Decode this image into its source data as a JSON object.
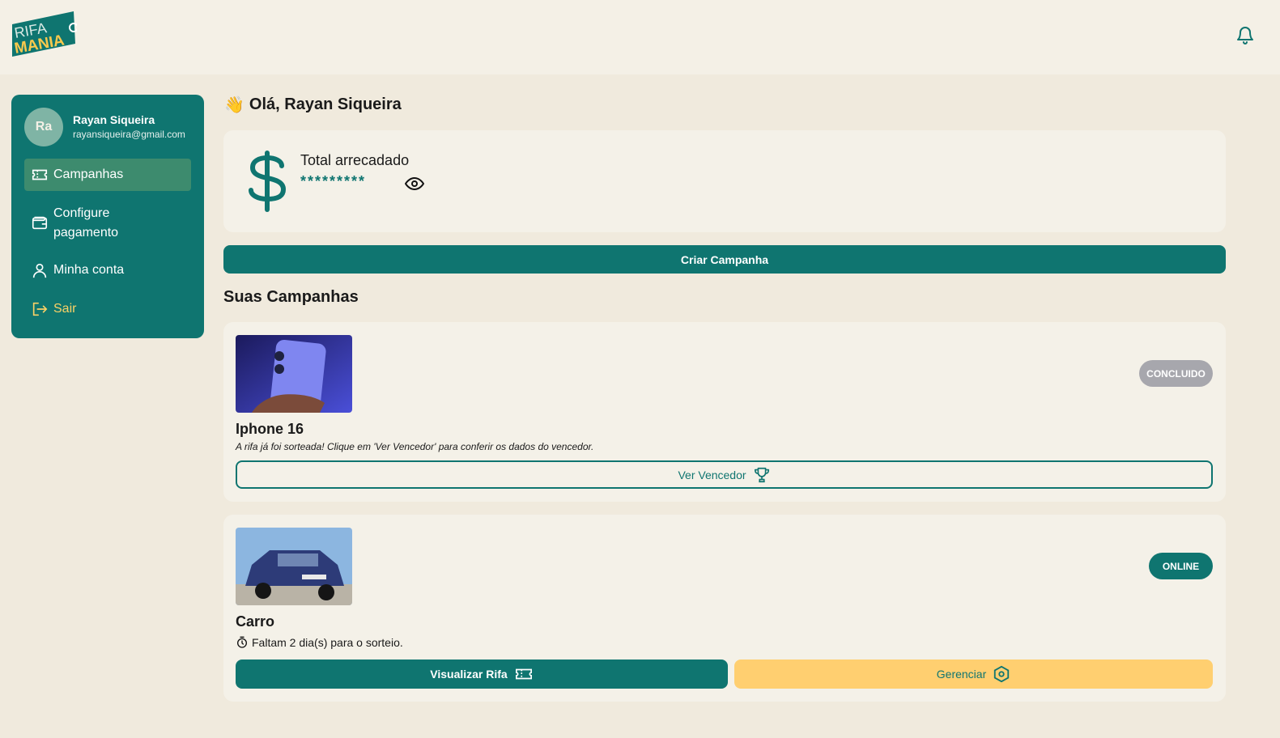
{
  "logo": {
    "line1": "RIFA",
    "line2": "MANIA"
  },
  "colors": {
    "primary": "#0f7570",
    "accent": "#ffcf70",
    "background": "#f0eadd",
    "card": "#f4f1e8"
  },
  "user": {
    "initials": "Ra",
    "name": "Rayan Siqueira",
    "email": "rayansiqueira@gmail.com"
  },
  "sidebar": {
    "items": [
      {
        "label": "Campanhas",
        "icon": "ticket-icon"
      },
      {
        "label": "Configure pagamento",
        "icon": "wallet-icon"
      },
      {
        "label": "Minha conta",
        "icon": "user-icon"
      },
      {
        "label": "Sair",
        "icon": "logout-icon"
      }
    ]
  },
  "greeting": {
    "emoji": "👋",
    "text": "Olá, Rayan Siqueira"
  },
  "total": {
    "label": "Total arrecadado",
    "masked_value": "*********"
  },
  "create_button": "Criar Campanha",
  "section_title": "Suas Campanhas",
  "campaigns": [
    {
      "title": "Iphone 16",
      "status": "CONCLUIDO",
      "description": "A rifa já foi sorteada! Clique em 'Ver Vencedor' para conferir os dados do vencedor.",
      "action": "Ver Vencedor"
    },
    {
      "title": "Carro",
      "status": "ONLINE",
      "description": "Faltam 2 dia(s) para o sorteio.",
      "view_action": "Visualizar Rifa",
      "manage_action": "Gerenciar"
    }
  ]
}
